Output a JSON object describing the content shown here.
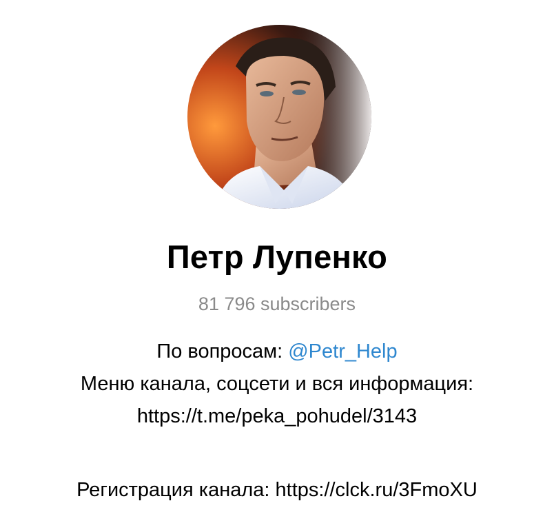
{
  "channel": {
    "name": "Петр Лупенко",
    "subscribers": "81 796 subscribers",
    "avatar_icon": "channel-avatar-photo"
  },
  "description": {
    "line1_prefix": "По вопросам: ",
    "line1_mention": "@Petr_Help",
    "line2": "Меню канала, соцсети и вся информация:",
    "line3_link": "https://t.me/peka_pohudel/3143",
    "line4_prefix": "Регистрация канала: ",
    "line4_link": "https://clck.ru/3FmoXU"
  },
  "colors": {
    "mention": "#2e87cf",
    "subscribers": "#8a8a8a",
    "text": "#000000"
  }
}
